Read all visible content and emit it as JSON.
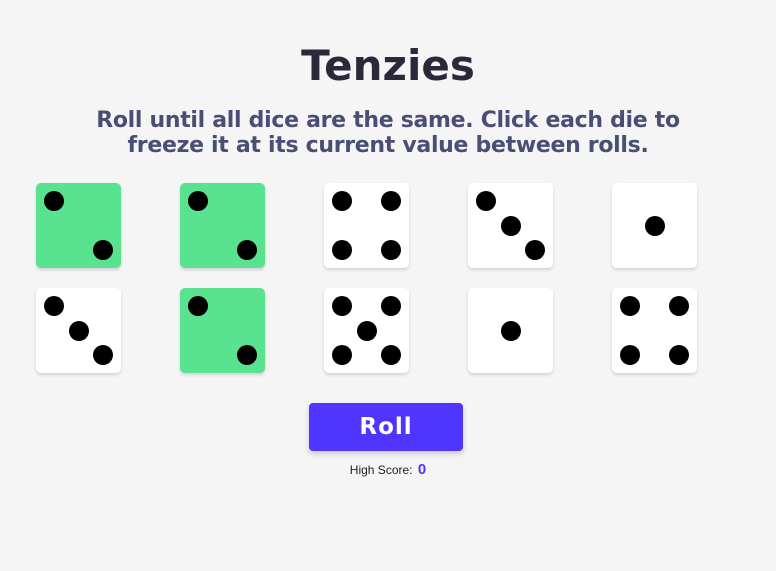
{
  "title": "Tenzies",
  "instructions": "Roll until all dice are the same. Click each die to freeze it at its current value between rolls.",
  "dice": [
    {
      "value": 2,
      "held": true
    },
    {
      "value": 2,
      "held": true
    },
    {
      "value": 4,
      "held": false
    },
    {
      "value": 3,
      "held": false
    },
    {
      "value": 1,
      "held": false
    },
    {
      "value": 3,
      "held": false
    },
    {
      "value": 2,
      "held": true
    },
    {
      "value": 5,
      "held": false
    },
    {
      "value": 1,
      "held": false
    },
    {
      "value": 4,
      "held": false
    }
  ],
  "roll_button_label": "Roll",
  "high_score_label": "High Score:",
  "high_score_value": "0",
  "colors": {
    "background": "#f5f5f5",
    "held_die": "#59e391",
    "die": "#ffffff",
    "button": "#5035ff",
    "title": "#2b283a",
    "instructions": "#4a4e74"
  }
}
